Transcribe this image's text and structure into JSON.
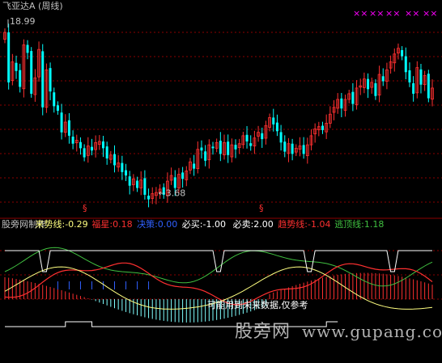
{
  "upper_panel": {
    "title": "飞亚达A (周线)",
    "high_label": "18.99",
    "low_label": "←3.68",
    "price_range": [
      2.8,
      20.6
    ],
    "marker_glyph": "×",
    "bottom_glyph": "§",
    "colors": {
      "up": "#ff3030",
      "down": "#00ffff",
      "grid": "#8b0000",
      "marker": "#ff00ff",
      "title": "#c0c0c0"
    },
    "weekly_close": [
      18.6,
      14.2,
      16.0,
      15.2,
      13.8,
      17.5,
      16.8,
      13.2,
      14.6,
      17.1,
      12.0,
      15.3,
      13.4,
      12.1,
      11.7,
      9.8,
      10.7,
      9.5,
      8.8,
      9.1,
      8.4,
      7.6,
      8.6,
      8.2,
      8.9,
      9.0,
      8.4,
      7.5,
      7.8,
      6.9,
      7.1,
      6.3,
      6.0,
      5.1,
      5.7,
      4.9,
      5.6,
      4.3,
      3.9,
      4.4,
      4.5,
      4.8,
      4.3,
      5.5,
      6.0,
      4.9,
      6.1,
      5.7,
      6.4,
      7.2,
      6.6,
      8.3,
      8.2,
      7.3,
      8.7,
      8.4,
      8.9,
      7.9,
      8.9,
      7.8,
      8.7,
      8.3,
      8.8,
      9.5,
      9.0,
      8.6,
      9.3,
      9.8,
      9.2,
      10.4,
      11.1,
      10.5,
      9.9,
      8.9,
      8.1,
      8.8,
      7.9,
      8.4,
      8.6,
      7.9,
      8.7,
      9.5,
      10.1,
      10.3,
      10.0,
      10.6,
      11.4,
      12.0,
      12.7,
      11.9,
      12.7,
      13.2,
      12.3,
      13.7,
      13.9,
      14.5,
      13.6,
      14.2,
      13.0,
      14.9,
      14.3,
      15.3,
      16.0,
      16.7,
      17.2,
      16.5,
      15.1,
      14.2,
      13.2,
      15.5,
      14.0,
      14.8,
      12.8,
      13.7
    ]
  },
  "lower_panel": {
    "labels": [
      {
        "text": "股旁网制作",
        "color": "#c0c0c0"
      },
      {
        "text": "来势线:-0.29",
        "color": "#ffff80"
      },
      {
        "text": "福星:0.18",
        "color": "#ff3030"
      },
      {
        "text": "决策:0.00",
        "color": "#3060ff"
      },
      {
        "text": "必买:-1.00",
        "color": "#ffffff"
      },
      {
        "text": "必卖:2.00",
        "color": "#ffffff"
      },
      {
        "text": "趋势线:-1.04",
        "color": "#ff3030"
      },
      {
        "text": "逃顶线:1.18",
        "color": "#40c040"
      }
    ],
    "note": "可能用到未来数据,仅参考",
    "colors": {
      "trend": "#ff3030",
      "escape": "#40c040",
      "come": "#ffff80",
      "square": "#ffffff",
      "hist_pos": "#ff3030",
      "hist_neg": "#80ffff",
      "decision": "#3060ff"
    }
  },
  "watermark": {
    "cn": "股旁网",
    "url": "www.gupang.com",
    "color": "#d0d0d0"
  }
}
